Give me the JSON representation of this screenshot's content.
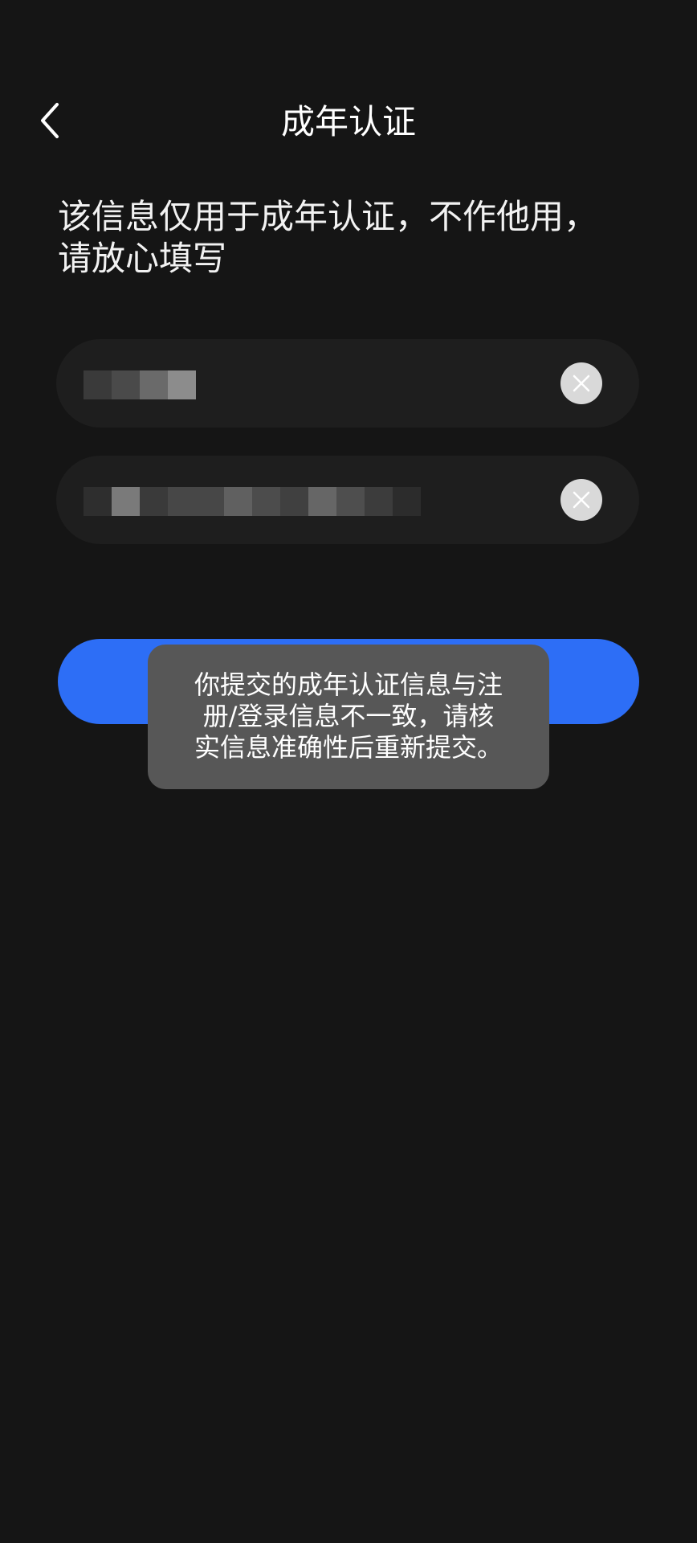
{
  "header": {
    "title": "成年认证",
    "back_icon": "chevron-left-icon"
  },
  "notice": {
    "line1": "该信息仅用于成年认证，不作他用，",
    "line2": "请放心填写"
  },
  "fields": {
    "name": {
      "value_masked": "[redacted name]",
      "clear_icon": "close-icon"
    },
    "id_number": {
      "value_masked": "[redacted ID number]",
      "clear_icon": "close-icon"
    }
  },
  "submit": {
    "label": ""
  },
  "toast": {
    "line1": "你提交的成年认证信息与注",
    "line2": "册/登录信息不一致，请核",
    "line3": "实信息准确性后重新提交。"
  },
  "colors": {
    "background": "#151515",
    "field_background": "#1e1e1e",
    "accent": "#2d6ef6",
    "toast_background": "#575757"
  }
}
